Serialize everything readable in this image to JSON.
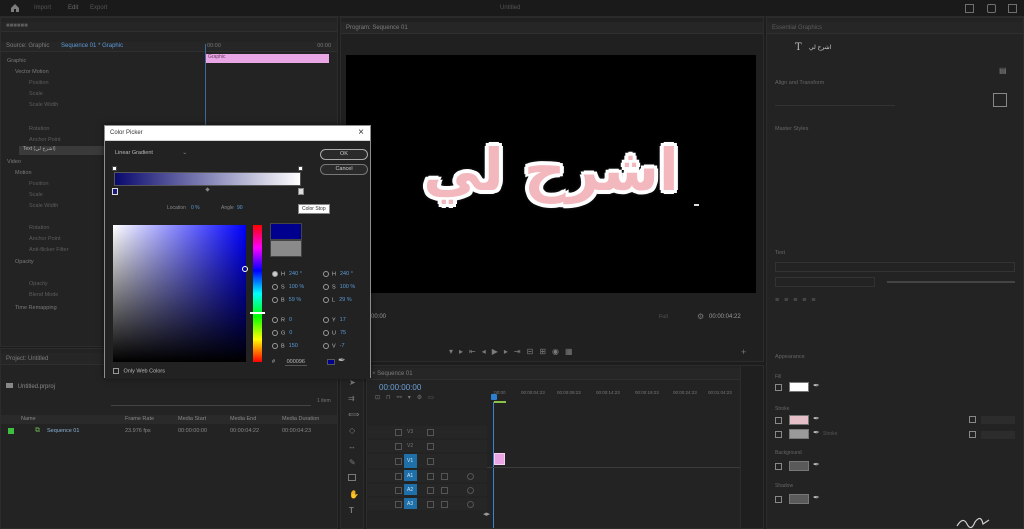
{
  "topbar": {
    "nav": [
      "Import",
      "Edit",
      "Export"
    ],
    "title": "Untitled"
  },
  "source_panel": {
    "tabs": [
      "Source: Graphic",
      "Sequence 01 * Graphic"
    ],
    "section": "Graphic",
    "rows": [
      "Vector Motion",
      "Position",
      "Scale",
      "Scale Width",
      "Rotation",
      "Anchor Point",
      "Text (اشرح لي)",
      "Video",
      "Motion",
      "Position",
      "Scale",
      "Scale Width",
      "Rotation",
      "Anchor Point",
      "Anti-flicker Filter",
      "Opacity",
      "Opacity",
      "Blend Mode",
      "Time Remapping"
    ],
    "timecodes": [
      "00:00",
      "00:00"
    ],
    "clip_label": "Graphic"
  },
  "program_monitor": {
    "tab": "Program: Sequence 01",
    "overlay_text": "اشرح لي",
    "timecode_left": "00:00",
    "timecode_right": "00:00:04:22",
    "fit": "Full"
  },
  "color_picker": {
    "title": "Color Picker",
    "close_glyph": "×",
    "fill_type": "Linear Gradient",
    "ok_label": "OK",
    "cancel_label": "Cancel",
    "location_label": "Location",
    "location_value": "0 %",
    "angle_label": "Angle",
    "angle_value": "90",
    "tooltip": "Color Stop",
    "only_web_colors": "Only Web Colors",
    "hex_prefix": "#",
    "hex_value": "000096",
    "hsb": [
      {
        "label": "H",
        "value": "240 °"
      },
      {
        "label": "S",
        "value": "100 %"
      },
      {
        "label": "B",
        "value": "59 %"
      }
    ],
    "hsl": [
      {
        "label": "H",
        "value": "240 °"
      },
      {
        "label": "S",
        "value": "100 %"
      },
      {
        "label": "L",
        "value": "29 %"
      }
    ],
    "rgb": [
      {
        "label": "R",
        "value": "0"
      },
      {
        "label": "G",
        "value": "0"
      },
      {
        "label": "B",
        "value": "150"
      }
    ],
    "yuv": [
      {
        "label": "Y",
        "value": "17"
      },
      {
        "label": "U",
        "value": "75"
      },
      {
        "label": "V",
        "value": "-7"
      }
    ],
    "colors": {
      "new": "#00008f",
      "current": "#8a8a8a",
      "gradient_start": "#0a0a6e",
      "gradient_end": "#ffffff"
    }
  },
  "project_panel": {
    "tab": "Project: Untitled",
    "bin": "Untitled.prproj",
    "items_count": "1 item",
    "columns": [
      "Name",
      "Frame Rate",
      "Media Start",
      "Media End",
      "Media Duration"
    ],
    "rows": [
      {
        "name": "Sequence 01",
        "frame_rate": "23.976 fps",
        "start": "00:00:00:00",
        "end": "00:00:04:22",
        "duration": "00:00:04:23"
      }
    ]
  },
  "timeline": {
    "tab": "Sequence 01",
    "timecode": "00:00:00:00",
    "ruler": [
      ":00:00",
      "00:00:04:23",
      "00:00:09:23",
      "00:00:14:23",
      "00:00:19:23",
      "00:00:24:23",
      "00:01:04:23",
      "00:0"
    ],
    "tracks": [
      "V3",
      "V2",
      "V1",
      "A1",
      "A2",
      "A3"
    ]
  },
  "essential_graphics": {
    "tab": "Essential Graphics",
    "layer": "اشرح لي",
    "sections": [
      "Align and Transform",
      "Master Styles",
      "Text",
      "Appearance"
    ],
    "appearance": [
      "Fill",
      "Stroke",
      "Stroke",
      "Background",
      "Shadow"
    ],
    "colors": {
      "fill": "#ffffff",
      "stroke1": "#e6c0c8",
      "stroke2": "#9a9a9a",
      "background": "#5a5a5a",
      "shadow": "#5a5a5a"
    }
  }
}
